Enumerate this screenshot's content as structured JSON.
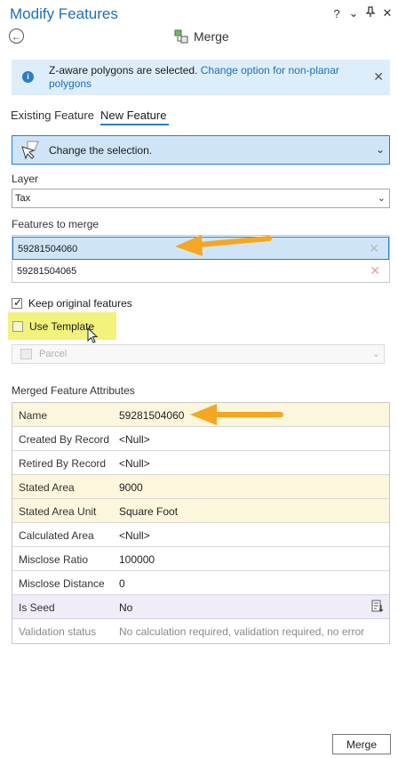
{
  "window": {
    "title": "Modify Features",
    "controls": {
      "help": "?",
      "menu": "⌄",
      "pin": "⊥",
      "close": "✕"
    }
  },
  "tool": {
    "title": "Merge"
  },
  "banner": {
    "message": "Z-aware polygons are selected. ",
    "link": "Change option for non-planar polygons"
  },
  "tabs": [
    {
      "label": "Existing Feature",
      "active": false
    },
    {
      "label": "New Feature",
      "active": true
    }
  ],
  "selection": {
    "label": "Change the selection."
  },
  "layer": {
    "label": "Layer",
    "value": "Tax"
  },
  "features_to_merge": {
    "label": "Features to merge",
    "items": [
      "59281504060",
      "59281504065"
    ]
  },
  "options": {
    "keep_original": {
      "label": "Keep original features",
      "checked": true
    },
    "use_template": {
      "label": "Use Template",
      "checked": false
    },
    "template_value": "Parcel"
  },
  "attributes": {
    "label": "Merged Feature Attributes",
    "rows": [
      {
        "key": "Name",
        "value": "59281504060",
        "style": "req"
      },
      {
        "key": "Created By Record",
        "value": "<Null>",
        "style": ""
      },
      {
        "key": "Retired By Record",
        "value": "<Null>",
        "style": ""
      },
      {
        "key": "Stated Area",
        "value": "9000",
        "style": "req"
      },
      {
        "key": "Stated Area Unit",
        "value": "Square Foot",
        "style": "req"
      },
      {
        "key": "Calculated Area",
        "value": "<Null>",
        "style": ""
      },
      {
        "key": "Misclose Ratio",
        "value": "100000",
        "style": ""
      },
      {
        "key": "Misclose Distance",
        "value": "0",
        "style": ""
      },
      {
        "key": "Is Seed",
        "value": "No",
        "style": "seed"
      },
      {
        "key": "Validation status",
        "value": "No calculation required, validation required, no error",
        "style": "dis"
      }
    ]
  },
  "footer": {
    "merge_label": "Merge"
  },
  "colors": {
    "accent": "#2c7cc7",
    "highlight": "#f2f27c",
    "arrow": "#f5a623"
  }
}
